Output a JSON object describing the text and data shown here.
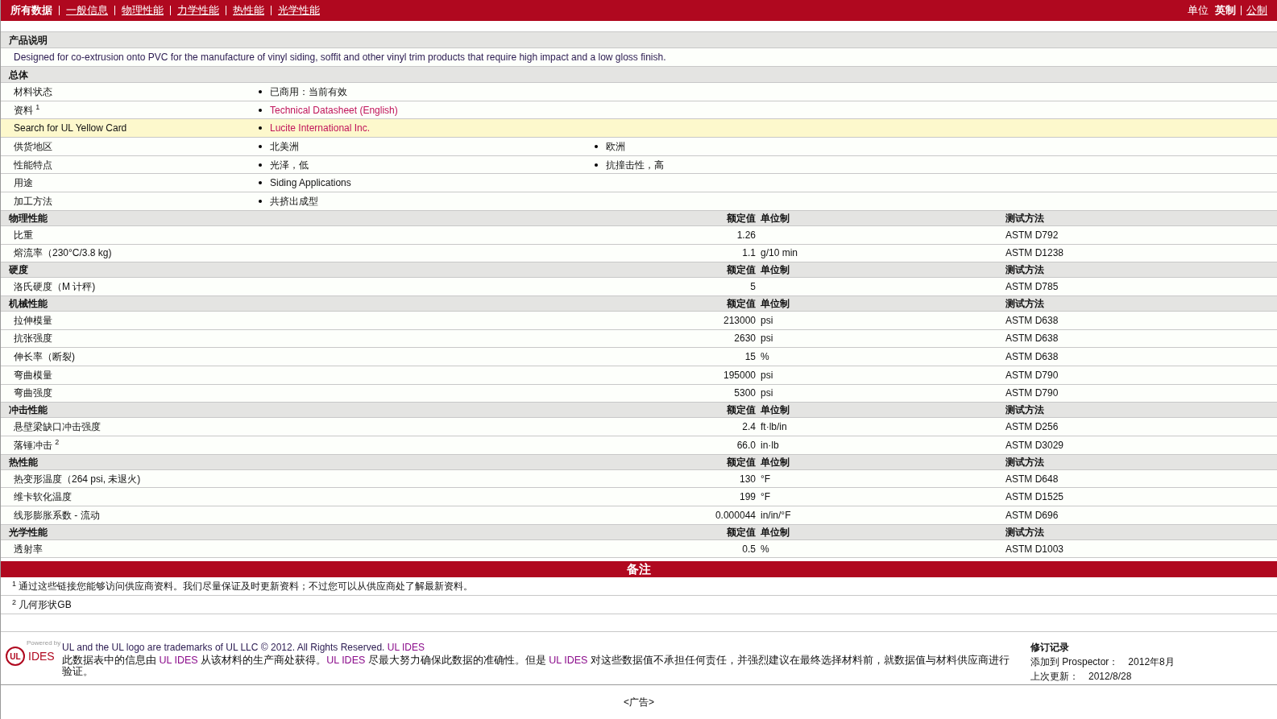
{
  "nav": {
    "tabs": [
      {
        "label": "所有数据",
        "selected": true
      },
      {
        "label": "一般信息",
        "selected": false
      },
      {
        "label": "物理性能",
        "selected": false
      },
      {
        "label": "力学性能",
        "selected": false
      },
      {
        "label": "热性能",
        "selected": false
      },
      {
        "label": "光学性能",
        "selected": false
      }
    ],
    "units_label": "单位",
    "units": [
      {
        "label": "英制",
        "selected": true
      },
      {
        "label": "公制",
        "selected": false
      }
    ]
  },
  "description": {
    "title": "产品说明",
    "text": "Designed for co-extrusion onto PVC for the manufacture of vinyl siding, soffit and other vinyl trim products that require high impact and a low gloss finish."
  },
  "general": {
    "title": "总体",
    "rows": [
      {
        "label": "材料状态",
        "highlighted": false,
        "values": [
          {
            "text": "已商用：当前有效",
            "link": false
          }
        ]
      },
      {
        "label": "资料 $^{1}$",
        "highlighted": false,
        "values": [
          {
            "text": "Technical Datasheet (English)",
            "link": true
          }
        ]
      },
      {
        "label": "Search for UL Yellow Card",
        "highlighted": true,
        "values": [
          {
            "text": "Lucite International Inc.",
            "link": true
          }
        ]
      },
      {
        "label": "供货地区",
        "highlighted": false,
        "values": [
          {
            "text": "北美洲",
            "link": false
          },
          {
            "text": "欧洲",
            "link": false
          }
        ]
      },
      {
        "label": "性能特点",
        "highlighted": false,
        "values": [
          {
            "text": "光泽，低",
            "link": false
          },
          {
            "text": "抗撞击性，高",
            "link": false
          }
        ]
      },
      {
        "label": "用途",
        "highlighted": false,
        "values": [
          {
            "text": "Siding Applications",
            "link": false
          }
        ]
      },
      {
        "label": "加工方法",
        "highlighted": false,
        "values": [
          {
            "text": "共挤出成型",
            "link": false
          }
        ]
      }
    ]
  },
  "sections": [
    {
      "title": "物理性能",
      "value_header": "额定值",
      "unit_header": "单位制",
      "method_header": "测试方法",
      "rows": [
        {
          "label": "比重",
          "value": "1.26",
          "method": "ASTM D792"
        },
        {
          "label": "熔流率（230°C/3.8 kg)",
          "value": "1.1",
          "unit": "g/10 min",
          "method": "ASTM D1238"
        }
      ]
    },
    {
      "title": "硬度",
      "value_header": "额定值",
      "unit_header": "单位制",
      "method_header": "测试方法",
      "rows": [
        {
          "label": "洛氏硬度（M 计秤)",
          "value": "5",
          "method": "ASTM D785"
        }
      ]
    },
    {
      "title": "机械性能",
      "value_header": "额定值",
      "unit_header": "单位制",
      "method_header": "测试方法",
      "rows": [
        {
          "label": "拉伸模量",
          "value": "213000",
          "unit": "psi",
          "method": "ASTM D638"
        },
        {
          "label": "抗张强度",
          "value": "2630",
          "unit": "psi",
          "method": "ASTM D638"
        },
        {
          "label": "伸长率（断裂)",
          "value": "15",
          "unit": "%",
          "method": "ASTM D638"
        },
        {
          "label": "弯曲模量",
          "value": "195000",
          "unit": "psi",
          "method": "ASTM D790"
        },
        {
          "label": "弯曲强度",
          "value": "5300",
          "unit": "psi",
          "method": "ASTM D790"
        }
      ]
    },
    {
      "title": "冲击性能",
      "value_header": "额定值",
      "unit_header": "单位制",
      "method_header": "测试方法",
      "rows": [
        {
          "label": "悬壁梁缺口冲击强度",
          "value": "2.4",
          "unit": "ft·lb/in",
          "method": "ASTM D256"
        },
        {
          "label": "落锤冲击 $^{2}$",
          "value": "66.0",
          "unit": "in·lb",
          "method": "ASTM D3029"
        }
      ]
    },
    {
      "title": "热性能",
      "value_header": "额定值",
      "unit_header": "单位制",
      "method_header": "测试方法",
      "rows": [
        {
          "label": "热变形温度（264 psi, 未退火)",
          "value": "130",
          "unit": "°F",
          "method": "ASTM D648"
        },
        {
          "label": "维卡软化温度",
          "value": "199",
          "unit": "°F",
          "method": "ASTM D1525"
        },
        {
          "label": "线形膨胀系数 - 流动",
          "value": "0.000044",
          "unit": "in/in/°F",
          "method": "ASTM D696"
        }
      ]
    },
    {
      "title": "光学性能",
      "value_header": "额定值",
      "unit_header": "单位制",
      "method_header": "测试方法",
      "rows": [
        {
          "label": "透射率",
          "value": "0.5",
          "unit": "%",
          "method": "ASTM D1003"
        }
      ]
    }
  ],
  "notes": {
    "title": "备注",
    "items": [
      "$^{1}$ 通过这些链接您能够访问供应商资料。我们尽量保证及时更新资料；不过您可以从供应商处了解最新资料。",
      "$^{2}$ 几何形状GB"
    ]
  },
  "footer": {
    "logo": {
      "powered": "Powered by",
      "mark": "UL",
      "caption": "IDES"
    },
    "trademark": [
      {
        "text": "UL and the UL logo are trademarks of UL LLC © 2012. All Rights Reserved. ",
        "link": false
      },
      {
        "text": "UL IDES",
        "link": true
      }
    ],
    "disclaimer": [
      {
        "text": "此数据表中的信息由 ",
        "link": false
      },
      {
        "text": "UL IDES",
        "link": true
      },
      {
        "text": " 从该材料的生产商处获得。",
        "link": false
      },
      {
        "text": "UL IDES",
        "link": true
      },
      {
        "text": " 尽最大努力确保此数据的准确性。但是 ",
        "link": false
      },
      {
        "text": "UL IDES",
        "link": true
      },
      {
        "text": " 对这些数据值不承担任何责任，并强烈建议在最终选择材料前，就数据值与材料供应商进行验证。",
        "link": false
      }
    ],
    "revision": {
      "title": "修订记录",
      "rows": [
        {
          "label": "添加到 Prospector：",
          "value": "2012年8月"
        },
        {
          "label": "上次更新：",
          "value": "2012/8/28"
        }
      ]
    }
  },
  "ad": "<广告>"
}
